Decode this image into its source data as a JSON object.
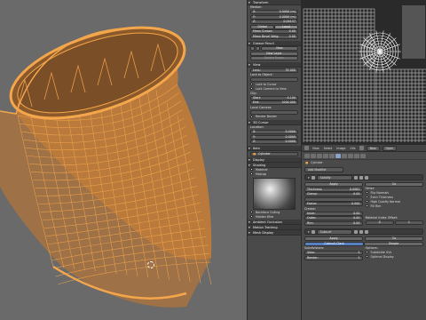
{
  "n_panel": {
    "transform": {
      "header": "Transform",
      "median_label": "Median:",
      "x_label": "X:",
      "x_value": "0.0000 (m)",
      "y_label": "Y:",
      "y_value": "0.0000 (m)",
      "z_label": "Z:",
      "z_value": "0.00137",
      "global_label": "Global",
      "local_label": "Local",
      "mean_crease_label": "Mean Crease:",
      "mean_crease_value": "0.00",
      "mean_bevel_label": "Mean Bevel Weig:",
      "mean_bevel_value": "0.00"
    },
    "grease_pencil": {
      "header": "Grease Pencil",
      "new_label": "New",
      "new_layer_label": "New Layer",
      "delete_frame_label": "Delete Frame"
    },
    "view": {
      "header": "View",
      "lens_label": "Lens:",
      "lens_value": "35.000",
      "lock_object_label": "Lock to Object:",
      "lock_cursor_label": "Lock to Cursor",
      "lock_camera_label": "Lock Camera to View",
      "clip_label": "Clip:",
      "start_label": "Start:",
      "start_value": "0.100",
      "end_label": "End:",
      "end_value": "1000.000",
      "local_camera_label": "Local Camera:",
      "render_border_label": "Render Border"
    },
    "cursor": {
      "header": "3D Cursor",
      "location_label": "Location:",
      "x_label": "X:",
      "x_value": "0.0000",
      "y_label": "Y:",
      "y_value": "0.0000",
      "z_label": "Z:",
      "z_value": "0.0000"
    },
    "item": {
      "header": "Item",
      "name_value": "Cylinder"
    },
    "display": {
      "header": "Display"
    },
    "shading": {
      "header": "Shading",
      "material_label": "Material",
      "matcap_label": "Matcap",
      "backface_label": "Backface Culling",
      "hidden_wire_label": "Hidden Wire"
    },
    "ambient": {
      "header": "Ambient Occlusion"
    },
    "motion": {
      "header": "Motion Tracking"
    },
    "mesh_display": {
      "header": "Mesh Display"
    }
  },
  "uv_header": {
    "menus": [
      "View",
      "Select",
      "Image",
      "UVs"
    ],
    "new_label": "New",
    "open_label": "Open"
  },
  "properties": {
    "object_name": "Cylinder",
    "add_modifier_label": "Add Modifier",
    "solidify": {
      "name": "Solidify",
      "apply_label": "Apply",
      "copy_label": "Co",
      "thickness_label": "Thickness:",
      "thickness_value": "0.0061",
      "clamp_label": "Clamp:",
      "clamp_value": "0.00",
      "vgroup_label": "",
      "factor_label": "Factor:",
      "factor_value": "0.000",
      "crease_label": "Crease:",
      "inner_label": "Inner:",
      "inner_value": "0.00",
      "outer_label": "Outer:",
      "outer_value": "0.00",
      "rim_label": "Rim:",
      "rim_value": "0.00",
      "other_label": "Other:",
      "flip_normals_label": "Flip Normals",
      "even_thickness_label": "Even Thickness",
      "high_quality_label": "High Quality Normal",
      "fill_rim_label": "Fill Rim",
      "material_offset_label": "Material Index Offset:",
      "mat_val_1": "0",
      "mat_val_2": "1"
    },
    "subsurf": {
      "name": "Subsurf",
      "apply_label": "Apply",
      "copy_label": "Co",
      "catmull_label": "Catmull-Clark",
      "simple_label": "Simple",
      "subdivisions_label": "Subdivisions:",
      "view_label": "View:",
      "view_value": "2",
      "render_label": "Render:",
      "render_value": "2",
      "options_label": "Options:",
      "subdivide_uvs_label": "Subdivide UVs",
      "optimal_display_label": "Optimal Display"
    }
  },
  "colors": {
    "viewport_bg": "#6a6a6a",
    "selection_orange": "#f3a64c",
    "panel_bg": "#4a4a4a",
    "active_blue": "#5680c2"
  }
}
